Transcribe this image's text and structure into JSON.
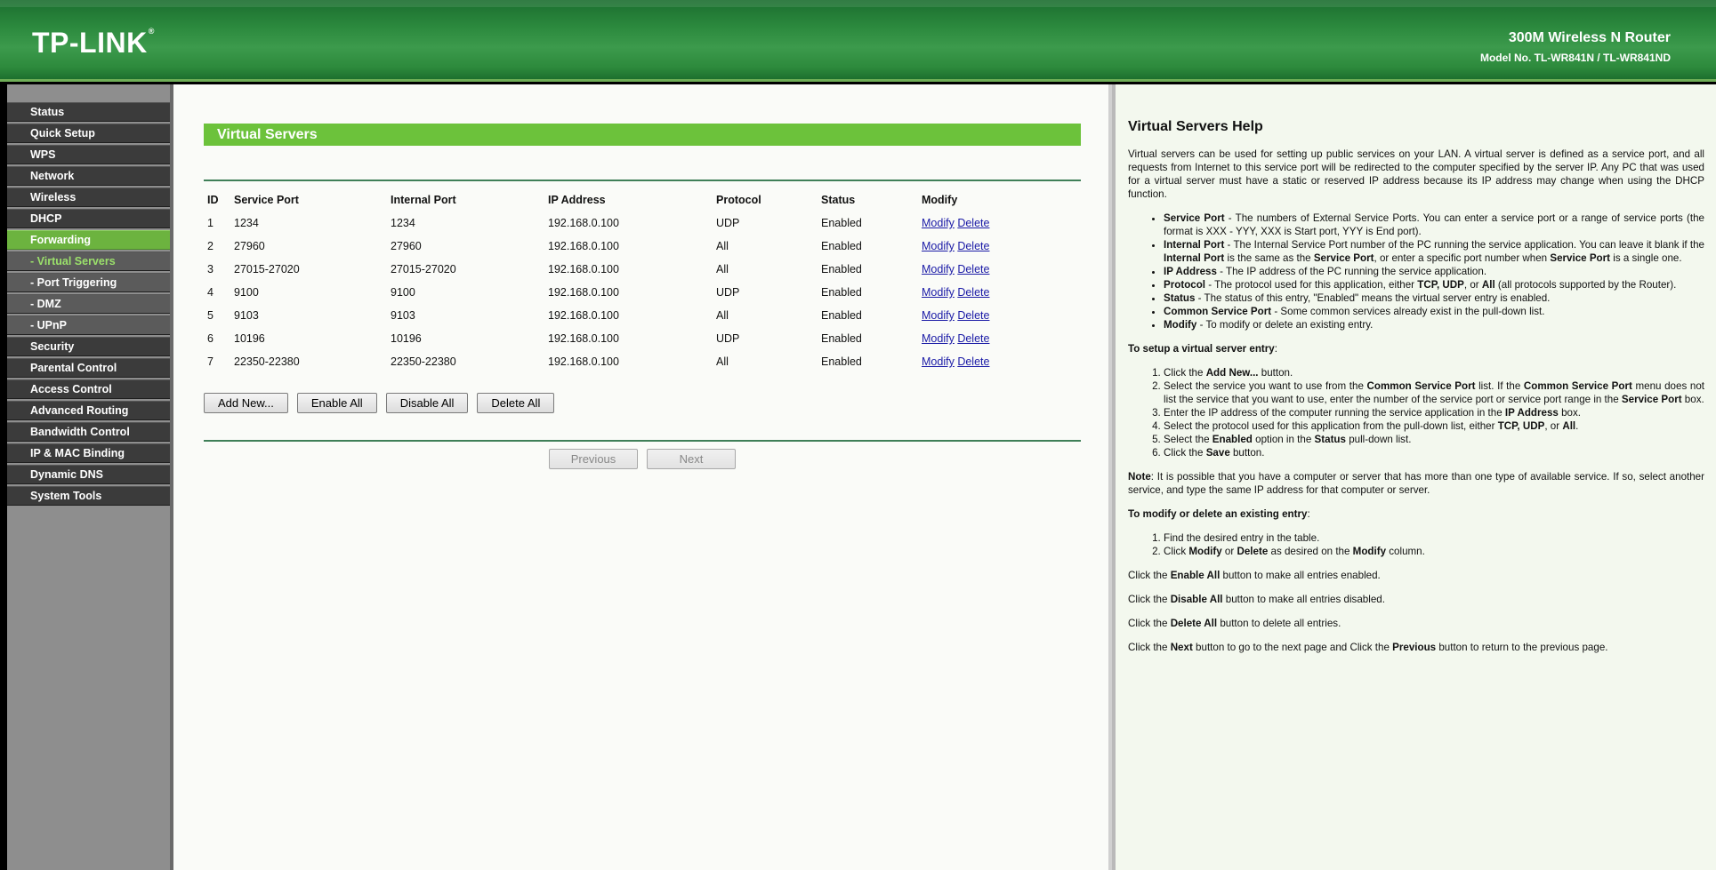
{
  "brand": {
    "logo": "TP-LINK",
    "registered": "®",
    "product_name": "300M Wireless N Router",
    "model": "Model No. TL-WR841N / TL-WR841ND"
  },
  "menu": [
    {
      "label": "Status"
    },
    {
      "label": "Quick Setup"
    },
    {
      "label": "WPS"
    },
    {
      "label": "Network"
    },
    {
      "label": "Wireless"
    },
    {
      "label": "DHCP"
    },
    {
      "label": "Forwarding"
    },
    {
      "label": "- Virtual Servers"
    },
    {
      "label": "- Port Triggering"
    },
    {
      "label": "- DMZ"
    },
    {
      "label": "- UPnP"
    },
    {
      "label": "Security"
    },
    {
      "label": "Parental Control"
    },
    {
      "label": "Access Control"
    },
    {
      "label": "Advanced Routing"
    },
    {
      "label": "Bandwidth Control"
    },
    {
      "label": "IP & MAC Binding"
    },
    {
      "label": "Dynamic DNS"
    },
    {
      "label": "System Tools"
    }
  ],
  "page": {
    "title": "Virtual Servers",
    "columns": [
      "ID",
      "Service Port",
      "Internal Port",
      "IP Address",
      "Protocol",
      "Status",
      "Modify"
    ],
    "rows": [
      {
        "id": "1",
        "service_port": "1234",
        "internal_port": "1234",
        "ip": "192.168.0.100",
        "protocol": "UDP",
        "status": "Enabled"
      },
      {
        "id": "2",
        "service_port": "27960",
        "internal_port": "27960",
        "ip": "192.168.0.100",
        "protocol": "All",
        "status": "Enabled"
      },
      {
        "id": "3",
        "service_port": "27015-27020",
        "internal_port": "27015-27020",
        "ip": "192.168.0.100",
        "protocol": "All",
        "status": "Enabled"
      },
      {
        "id": "4",
        "service_port": "9100",
        "internal_port": "9100",
        "ip": "192.168.0.100",
        "protocol": "UDP",
        "status": "Enabled"
      },
      {
        "id": "5",
        "service_port": "9103",
        "internal_port": "9103",
        "ip": "192.168.0.100",
        "protocol": "All",
        "status": "Enabled"
      },
      {
        "id": "6",
        "service_port": "10196",
        "internal_port": "10196",
        "ip": "192.168.0.100",
        "protocol": "UDP",
        "status": "Enabled"
      },
      {
        "id": "7",
        "service_port": "22350-22380",
        "internal_port": "22350-22380",
        "ip": "192.168.0.100",
        "protocol": "All",
        "status": "Enabled"
      }
    ],
    "modify_label": "Modify",
    "delete_label": "Delete",
    "buttons": {
      "add_new": "Add New...",
      "enable_all": "Enable All",
      "disable_all": "Disable All",
      "delete_all": "Delete All",
      "previous": "Previous",
      "next": "Next"
    }
  },
  "help": {
    "title": "Virtual Servers Help",
    "intro": "Virtual servers can be used for setting up public services on your LAN. A virtual server is defined as a service port, and all requests from Internet to this service port will be redirected to the computer specified by the server IP. Any PC that was used for a virtual server must have a static or reserved IP address because its IP address may change when using the DHCP function.",
    "defs": {
      "sp_term": "Service Port",
      "sp_text": " - The numbers of External Service Ports. You can enter a service port or a range of service ports (the format is XXX - YYY, XXX is Start port, YYY is End port).",
      "ip_term": "Internal Port",
      "ip_text1": " - The Internal Service Port number of the PC running the service application. You can leave it blank if the ",
      "ip_term2": "Internal Port",
      "ip_text2": " is the same as the ",
      "ip_term3": "Service Port",
      "ip_text3": ", or enter a specific port number when ",
      "ip_term4": "Service Port",
      "ip_text4": " is a single one.",
      "addr_term": "IP Address",
      "addr_text": " - The IP address of the PC running the service application.",
      "proto_term": "Protocol",
      "proto_text1": " - The protocol used for this application, either ",
      "proto_opts": "TCP, UDP",
      "proto_text2": ", or ",
      "proto_all": "All",
      "proto_text3": " (all protocols supported by the Router).",
      "status_term": "Status",
      "status_text": " - The status of this entry, \"Enabled\" means the virtual server entry is enabled.",
      "csp_term": "Common Service Port",
      "csp_text": " - Some common services already exist in the pull-down list.",
      "mod_term": "Modify",
      "mod_text": " - To modify or delete an existing entry."
    },
    "setup_heading": "To setup a virtual server entry",
    "setup_colon": ":",
    "setup": {
      "s1a": "Click the ",
      "s1b": "Add New...",
      "s1c": " button.",
      "s2a": "Select the service you want to use from the ",
      "s2b": "Common Service Port",
      "s2c": " list. If the ",
      "s2d": "Common Service Port",
      "s2e": " menu does not list the service that you want to use, enter the number of the service port or service port range in the ",
      "s2f": "Service Port",
      "s2g": " box.",
      "s3a": "Enter the IP address of the computer running the service application in the ",
      "s3b": "IP Address",
      "s3c": " box.",
      "s4a": "Select the protocol used for this application from the pull-down list, either ",
      "s4b": "TCP, UDP",
      "s4c": ", or ",
      "s4d": "All",
      "s4e": ".",
      "s5a": "Select the ",
      "s5b": "Enabled",
      "s5c": " option in the ",
      "s5d": "Status",
      "s5e": " pull-down list.",
      "s6a": "Click the ",
      "s6b": "Save",
      "s6c": " button."
    },
    "note_term": "Note",
    "note_text": ": It is possible that you have a computer or server that has more than one type of available service. If so, select another service, and type the same IP address for that computer or server.",
    "modify_heading": "To modify or delete an existing entry",
    "modify": {
      "m1": "Find the desired entry in the table.",
      "m2a": "Click ",
      "m2b": "Modify",
      "m2c": " or ",
      "m2d": "Delete",
      "m2e": " as desired on the ",
      "m2f": "Modify",
      "m2g": " column."
    },
    "click_the": "Click the ",
    "enable_all": "Enable All",
    "enable_text": " button to make all entries enabled.",
    "disable_all": "Disable All",
    "disable_text": " button to make all entries disabled.",
    "delete_all": "Delete All",
    "delete_text": " button to delete all entries.",
    "next": "Next",
    "next_text": " button to go to the next page and Click the ",
    "previous": "Previous",
    "prev_text": " button to return to the previous page."
  },
  "colors": {
    "header_green": "#2c8a3e",
    "accent_green": "#6cc23b",
    "menu_dark": "#3b3b3b",
    "link_blue": "#1a1aa6"
  }
}
